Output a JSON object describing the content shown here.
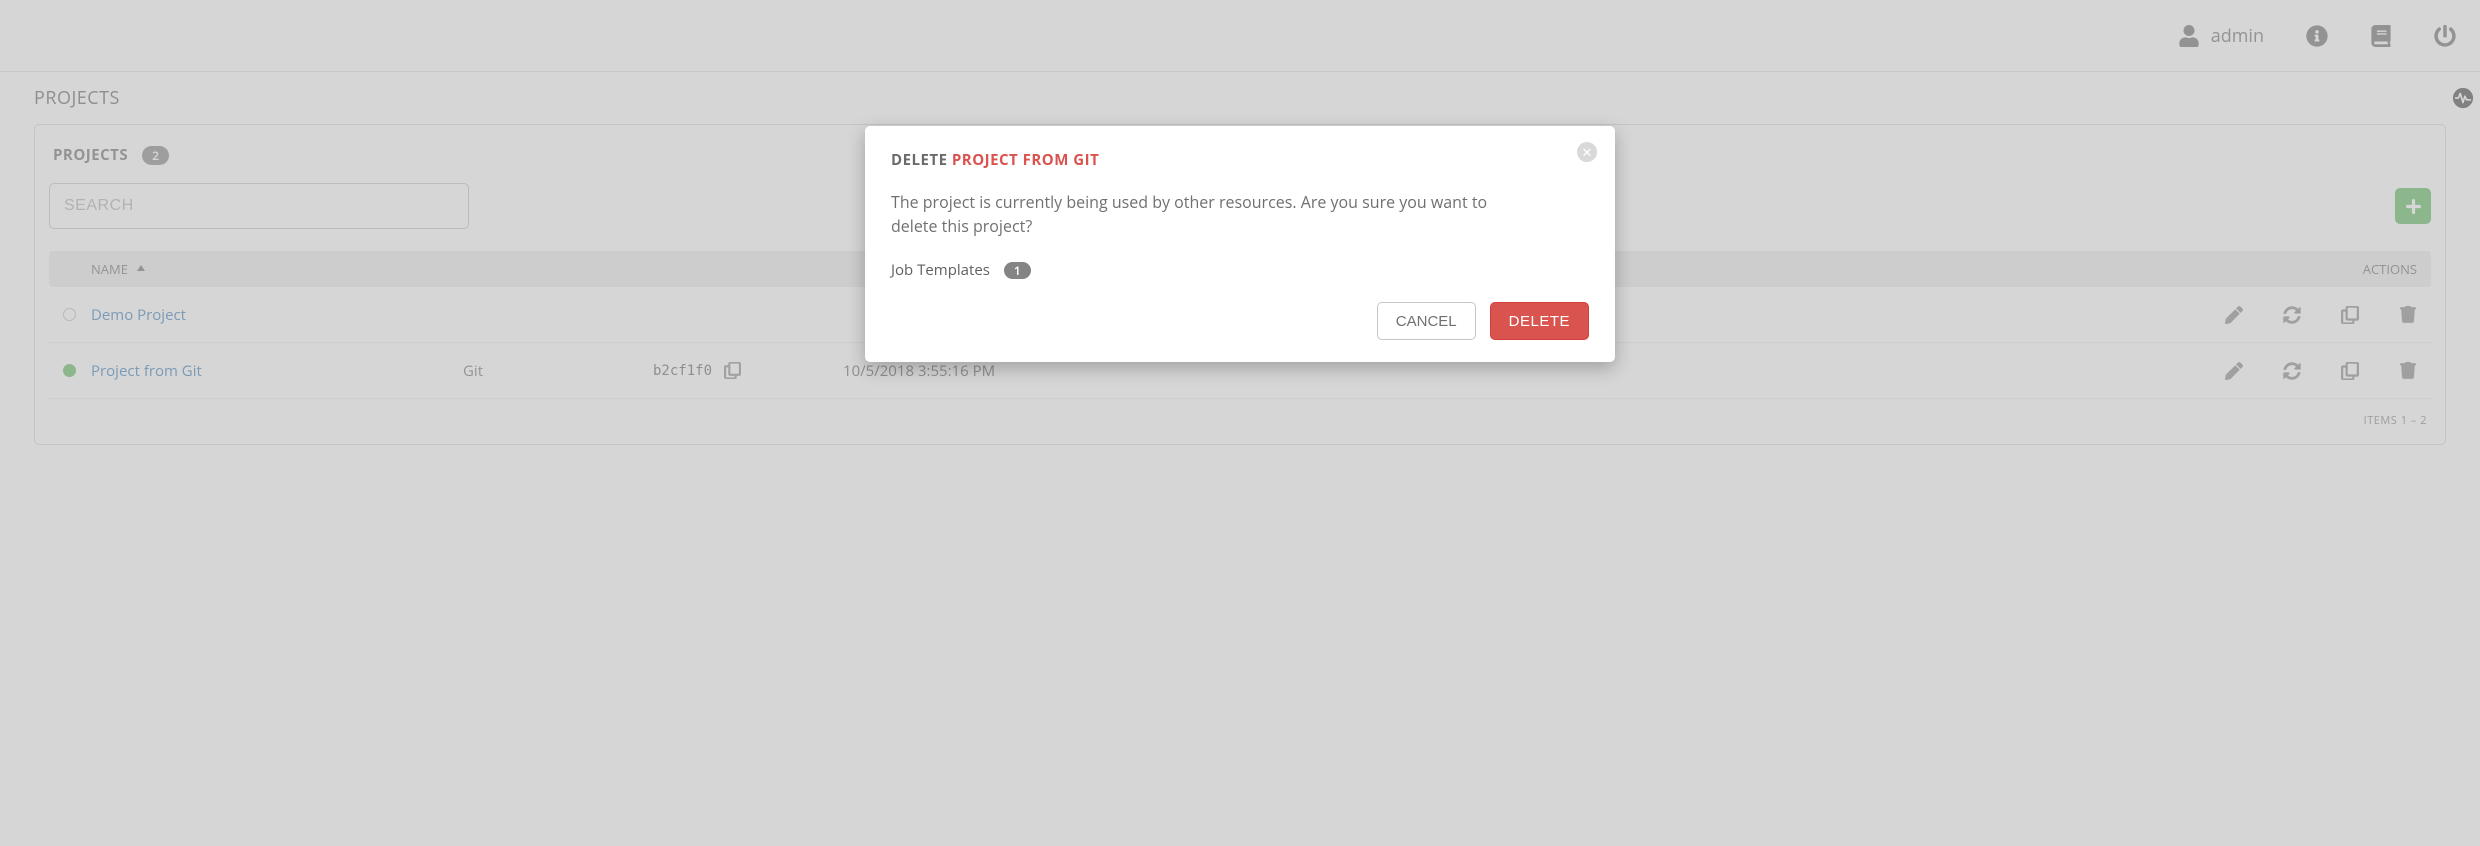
{
  "topbar": {
    "username": "admin"
  },
  "page": {
    "breadcrumb": "PROJECTS"
  },
  "panel": {
    "title": "PROJECTS",
    "count": "2",
    "search_placeholder": "SEARCH"
  },
  "table": {
    "columns": {
      "name": "NAME",
      "actions": "ACTIONS"
    },
    "rows": [
      {
        "status": "never",
        "name": "Demo Project",
        "type": "",
        "revision": "",
        "date": ""
      },
      {
        "status": "running",
        "name": "Project from Git",
        "type": "Git",
        "revision": "b2cf1f0",
        "date": "10/5/2018 3:55:16 PM"
      }
    ],
    "items_label": "ITEMS  1 – 2"
  },
  "modal": {
    "title_prefix": "DELETE ",
    "title_target": "PROJECT FROM GIT",
    "message": "The project is currently being used by other resources. Are you sure you want to delete this project?",
    "dep_label": "Job Templates",
    "dep_count": "1",
    "cancel": "CANCEL",
    "delete": "DELETE"
  }
}
